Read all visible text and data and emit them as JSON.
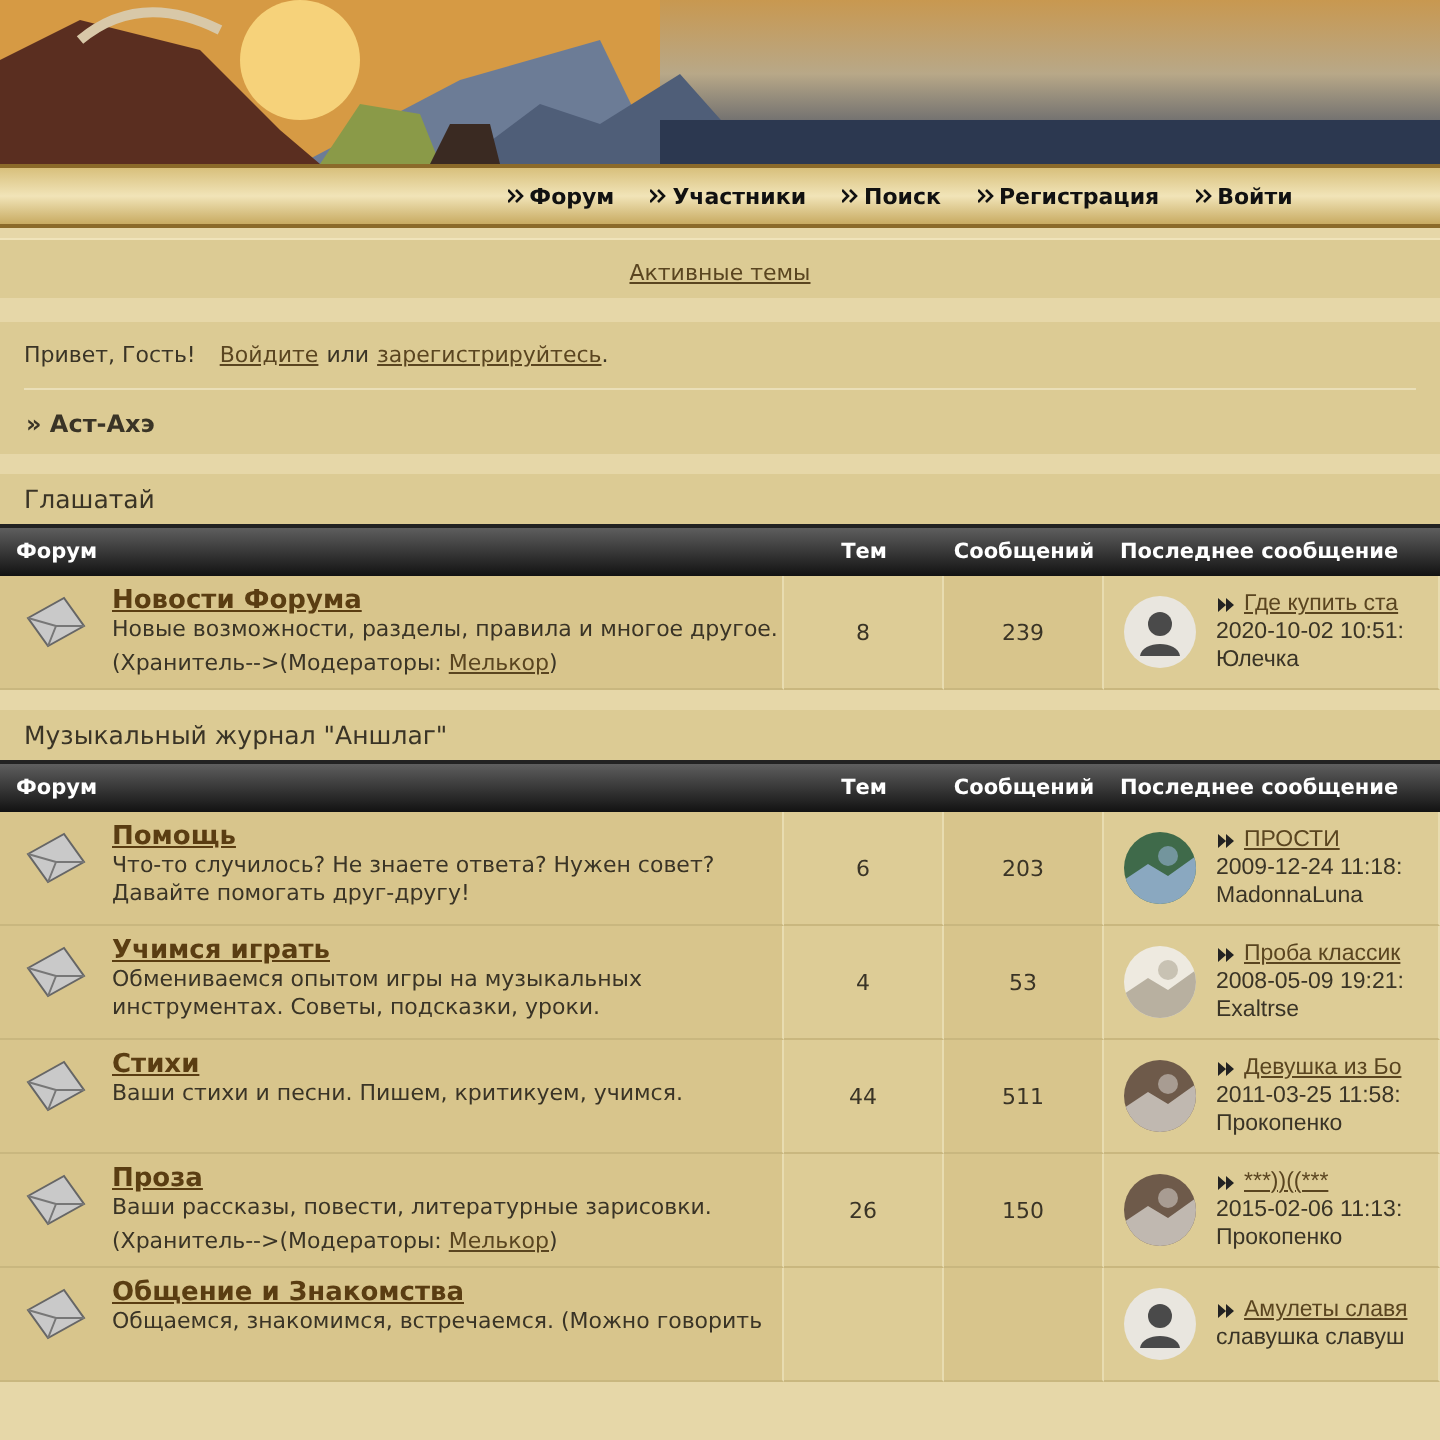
{
  "nav": [
    "Форум",
    "Участники",
    "Поиск",
    "Регистрация",
    "Войти"
  ],
  "active_link": "Активные темы",
  "greeting": {
    "text": "Привет, Гость!",
    "login": "Войдите",
    "or": "или",
    "register": "зарегистрируйтесь",
    "end": "."
  },
  "breadcrumb": "» Аст-Ахэ",
  "sections": [
    {
      "title": "Глашатай",
      "columns": [
        "Форум",
        "Тем",
        "Сообщений",
        "Последнее сообщение"
      ],
      "rows": [
        {
          "title": "Новости Форума",
          "description": "Новые возможности, разделы, правила и многое другое.",
          "moderators": {
            "prefix": "(Хранитель-->(Модераторы: ",
            "name": "Мелькор",
            "suffix": ")"
          },
          "topics": "8",
          "posts": "239",
          "last": {
            "kind": "default",
            "topic": "Где купить ста",
            "date": "2020-10-02 10:51:",
            "author": "Юлечка"
          }
        }
      ]
    },
    {
      "title": "Музыкальный журнал \"Аншлаг\"",
      "columns": [
        "Форум",
        "Тем",
        "Сообщений",
        "Последнее сообщение"
      ],
      "rows": [
        {
          "title": "Помощь",
          "description": "Что-то случилось? Не знаете ответа? Нужен совет? Давайте помогать друг-другу!",
          "topics": "6",
          "posts": "203",
          "last": {
            "kind": "picture",
            "topic": "ПРОСТИ",
            "date": "2009-12-24 11:18:",
            "author": "MadonnaLuna"
          }
        },
        {
          "title": "Учимся играть",
          "description": "Обмениваемся опытом игры на музыкальных инструментах. Советы, подсказки, уроки.",
          "topics": "4",
          "posts": "53",
          "last": {
            "kind": "picture",
            "topic": "Проба классик",
            "date": "2008-05-09 19:21:",
            "author": "Exaltrse"
          }
        },
        {
          "title": "Стихи",
          "description": "Ваши стихи и песни. Пишем, критикуем, учимся.",
          "topics": "44",
          "posts": "511",
          "last": {
            "kind": "picture",
            "topic": "Девушка из Бо",
            "date": "2011-03-25 11:58:",
            "author": "Прокопенко"
          }
        },
        {
          "title": "Проза",
          "description": "Ваши рассказы, повести, литературные зарисовки.",
          "moderators": {
            "prefix": "(Хранитель-->(Модераторы: ",
            "name": "Мелькор",
            "suffix": ")"
          },
          "topics": "26",
          "posts": "150",
          "last": {
            "kind": "picture",
            "topic": "***))((***",
            "date": "2015-02-06 11:13:",
            "author": "Прокопенко"
          }
        },
        {
          "title": "Общение и Знакомства",
          "description": "Общаемся, знакомимся, встречаемся. (Можно говорить",
          "last": {
            "kind": "default",
            "topic": "Амулеты славя",
            "excerpt": "славушка славуш"
          }
        }
      ]
    }
  ]
}
